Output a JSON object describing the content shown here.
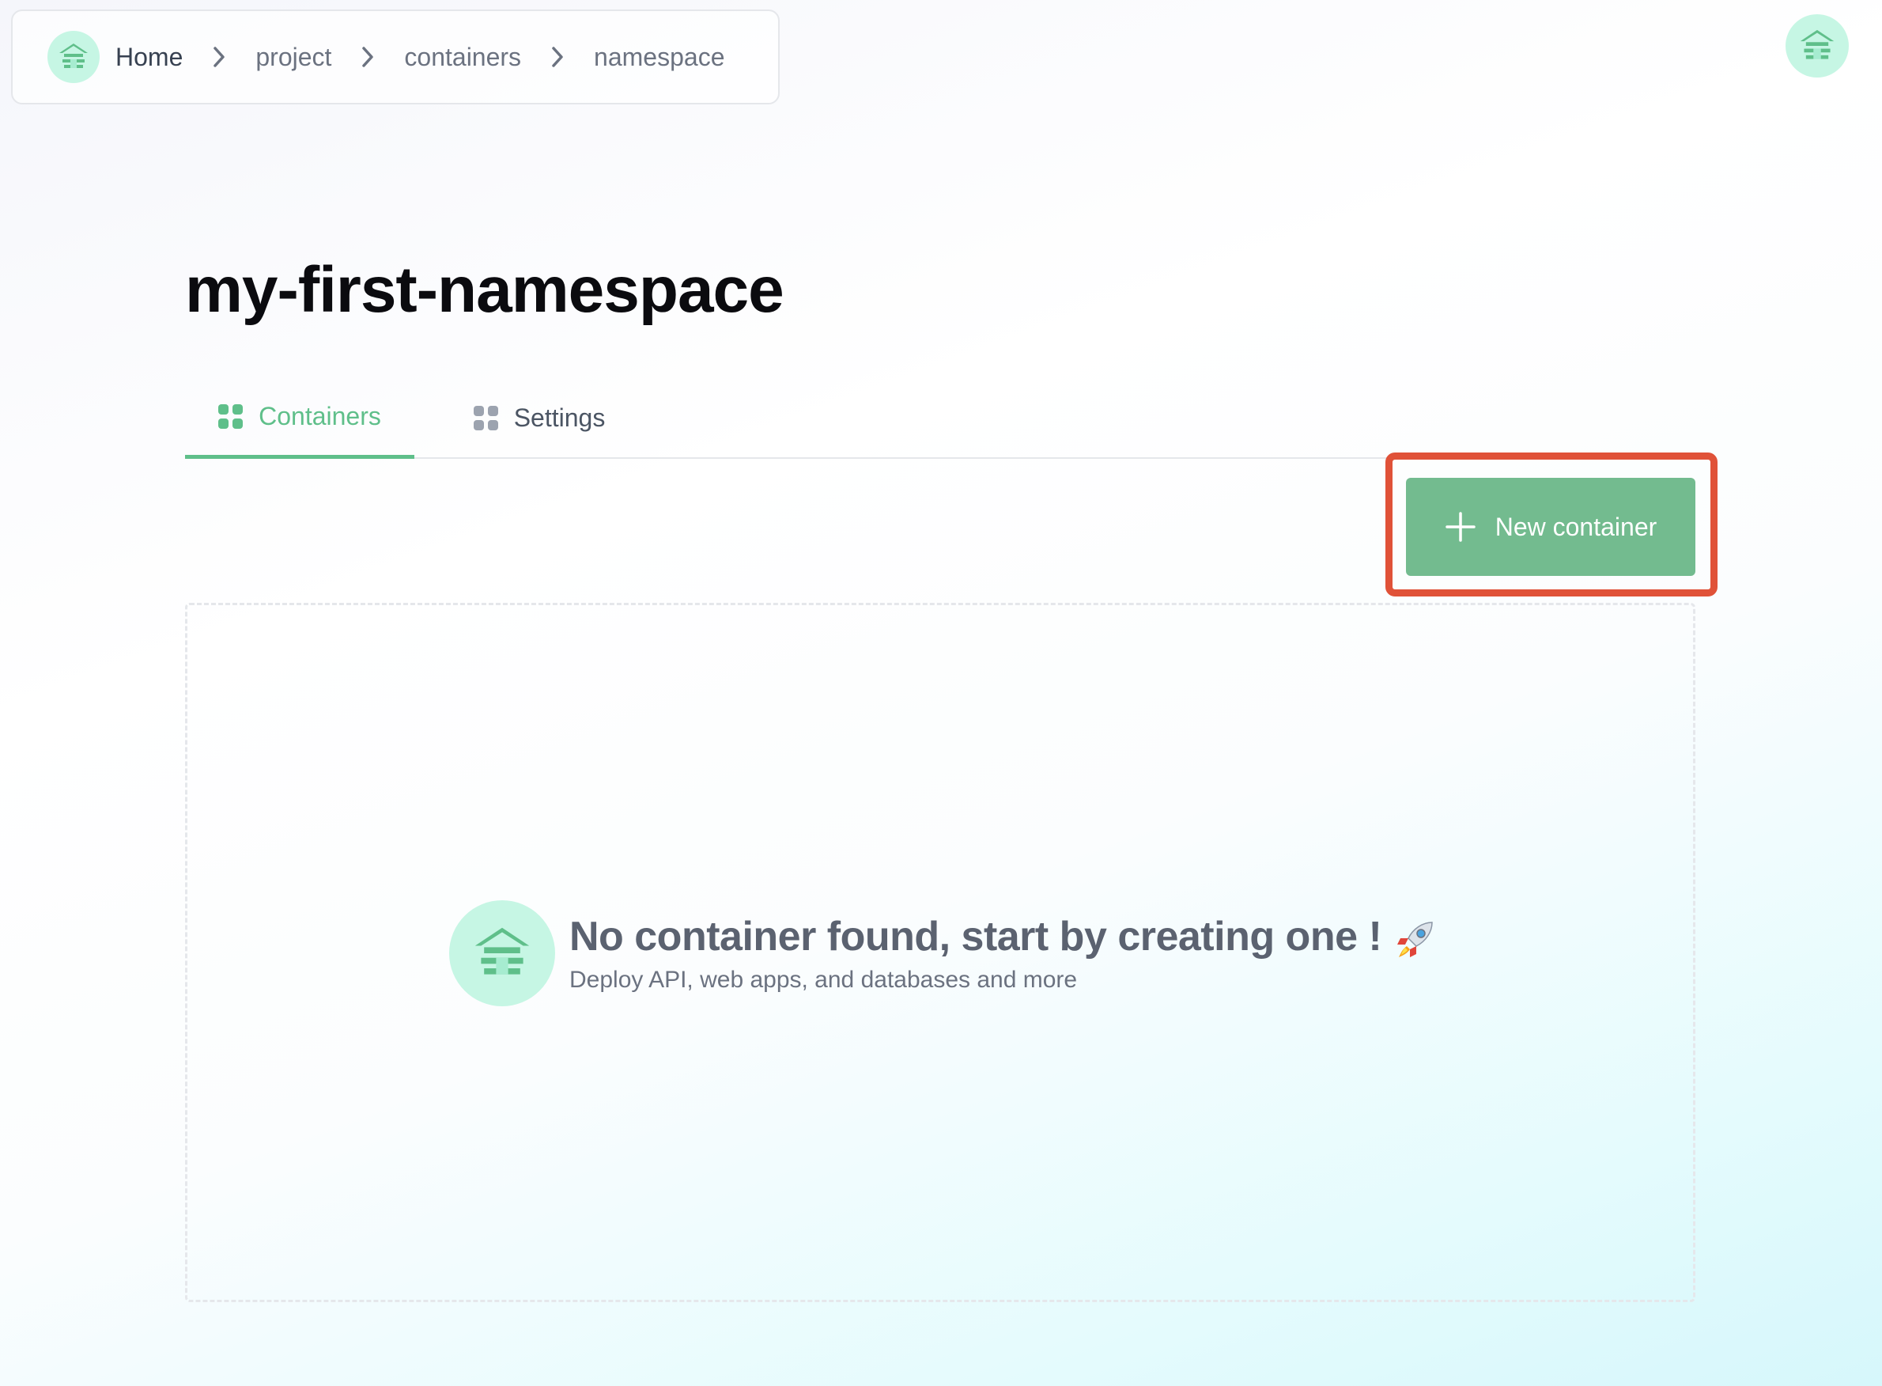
{
  "breadcrumb": {
    "items": [
      {
        "label": "Home"
      },
      {
        "label": "project"
      },
      {
        "label": "containers"
      },
      {
        "label": "namespace"
      }
    ]
  },
  "page": {
    "title": "my-first-namespace"
  },
  "tabs": [
    {
      "label": "Containers",
      "active": true,
      "icon": "grid-icon"
    },
    {
      "label": "Settings",
      "active": false,
      "icon": "grid-icon"
    }
  ],
  "toolbar": {
    "new_container_label": "New container",
    "new_container_icon": "plus-icon"
  },
  "empty_state": {
    "title": "No container found, start by creating one !",
    "subtitle": "Deploy API, web apps, and databases and more",
    "icon": "rocket-icon"
  },
  "colors": {
    "accent": "#5fbf8a",
    "button": "#73bb8f",
    "highlight": "#e05238",
    "logo_bg": "#c6f6e4"
  }
}
